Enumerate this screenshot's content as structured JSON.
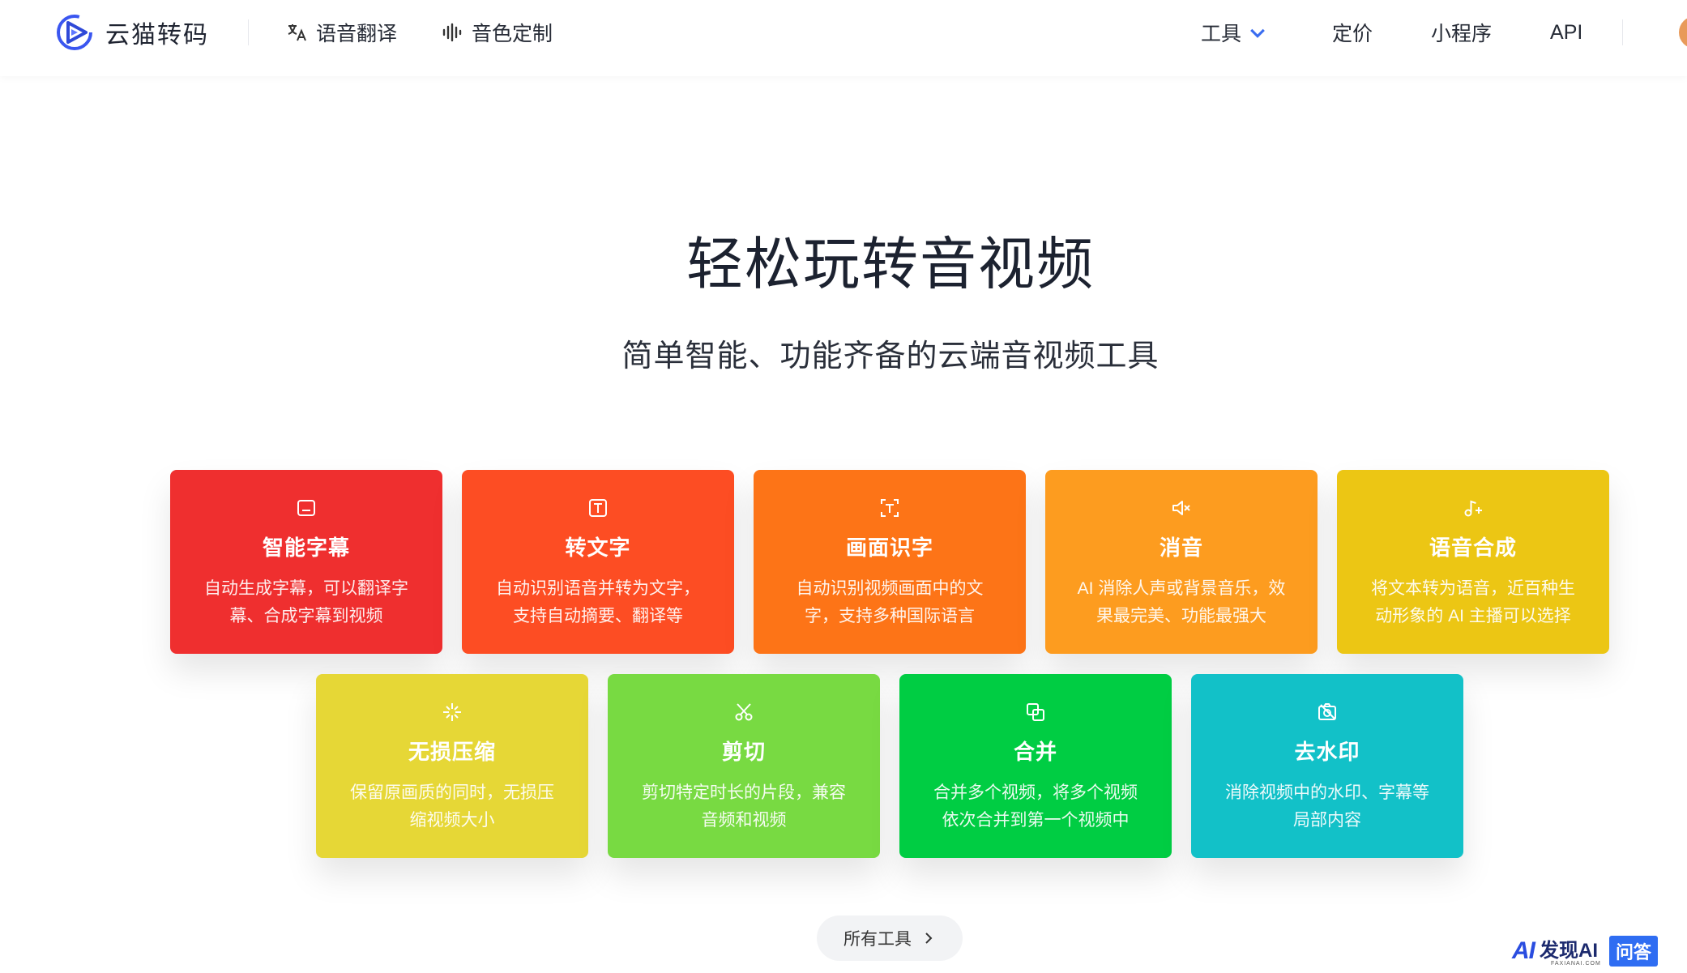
{
  "header": {
    "brand": "云猫转码",
    "nav_left": [
      {
        "label": "语音翻译",
        "icon": "translate-icon"
      },
      {
        "label": "音色定制",
        "icon": "waveform-icon"
      }
    ],
    "nav_right": [
      {
        "label": "工具",
        "icon": "chevron-down-icon"
      },
      {
        "label": "定价"
      },
      {
        "label": "小程序"
      },
      {
        "label": "API"
      }
    ]
  },
  "hero": {
    "title": "轻松玩转音视频",
    "subtitle": "简单智能、功能齐备的云端音视频工具"
  },
  "tools": [
    {
      "title": "智能字幕",
      "desc": "自动生成字幕，可以翻译字幕、合成字幕到视频",
      "color": "#ef2f2f",
      "icon": "subtitle-icon"
    },
    {
      "title": "转文字",
      "desc": "自动识别语音并转为文字，支持自动摘要、翻译等",
      "color": "#fd4d23",
      "icon": "text-icon"
    },
    {
      "title": "画面识字",
      "desc": "自动识别视频画面中的文字，支持多种国际语言",
      "color": "#fd7417",
      "icon": "scan-text-icon"
    },
    {
      "title": "消音",
      "desc": "AI 消除人声或背景音乐，效果最完美、功能最强大",
      "color": "#fd9c1f",
      "icon": "mute-icon"
    },
    {
      "title": "语音合成",
      "desc": "将文本转为语音，近百种生动形象的 AI 主播可以选择",
      "color": "#ecc614",
      "icon": "music-add-icon"
    },
    {
      "title": "无损压缩",
      "desc": "保留原画质的同时，无损压缩视频大小",
      "color": "#e6d736",
      "icon": "compress-icon"
    },
    {
      "title": "剪切",
      "desc": "剪切特定时长的片段，兼容音频和视频",
      "color": "#78da42",
      "icon": "scissors-icon"
    },
    {
      "title": "合并",
      "desc": "合并多个视频，将多个视频依次合并到第一个视频中",
      "color": "#00cd43",
      "icon": "merge-icon"
    },
    {
      "title": "去水印",
      "desc": "消除视频中的水印、字幕等局部内容",
      "color": "#12c1c8",
      "icon": "watermark-remove-icon"
    }
  ],
  "all_tools_label": "所有工具",
  "watermark": {
    "brand": "发现AI",
    "badge": "问答",
    "sub": "FAXIANAI.COM"
  }
}
